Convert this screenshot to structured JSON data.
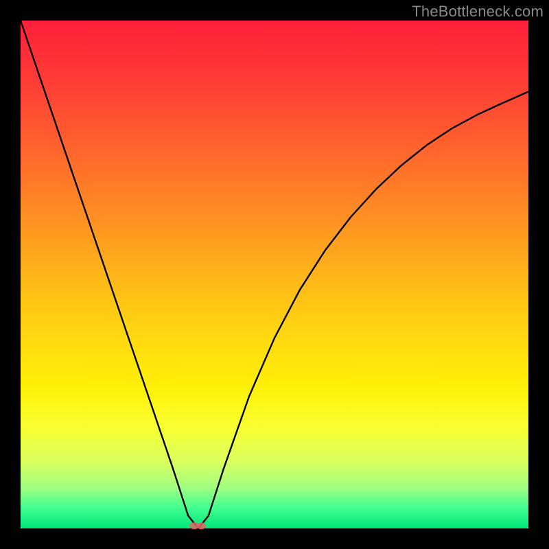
{
  "watermark": "TheBottleneck.com",
  "chart_data": {
    "type": "line",
    "title": "",
    "xlabel": "",
    "ylabel": "",
    "xlim": [
      0,
      100
    ],
    "ylim": [
      0,
      100
    ],
    "series": [
      {
        "name": "bottleneck-curve",
        "x": [
          0,
          5,
          10,
          15,
          20,
          25,
          30,
          33,
          35,
          37,
          40,
          45,
          50,
          55,
          60,
          65,
          70,
          75,
          80,
          85,
          90,
          95,
          100
        ],
        "y": [
          100,
          85.3,
          70.6,
          55.9,
          41.2,
          26.5,
          11.8,
          2.5,
          0,
          2.5,
          11.8,
          26.0,
          37.5,
          47.0,
          54.8,
          61.3,
          66.8,
          71.5,
          75.5,
          78.8,
          81.5,
          83.8,
          86.0
        ]
      }
    ],
    "markers": [
      {
        "name": "optimal-point-1",
        "x": 34.2,
        "y": 0.5
      },
      {
        "name": "optimal-point-2",
        "x": 35.6,
        "y": 0.5
      }
    ],
    "background_gradient": {
      "top": "#ff1f3a",
      "upper_mid": "#ff9a20",
      "mid": "#fff008",
      "lower_mid": "#d8ff60",
      "bottom": "#00e676"
    }
  }
}
